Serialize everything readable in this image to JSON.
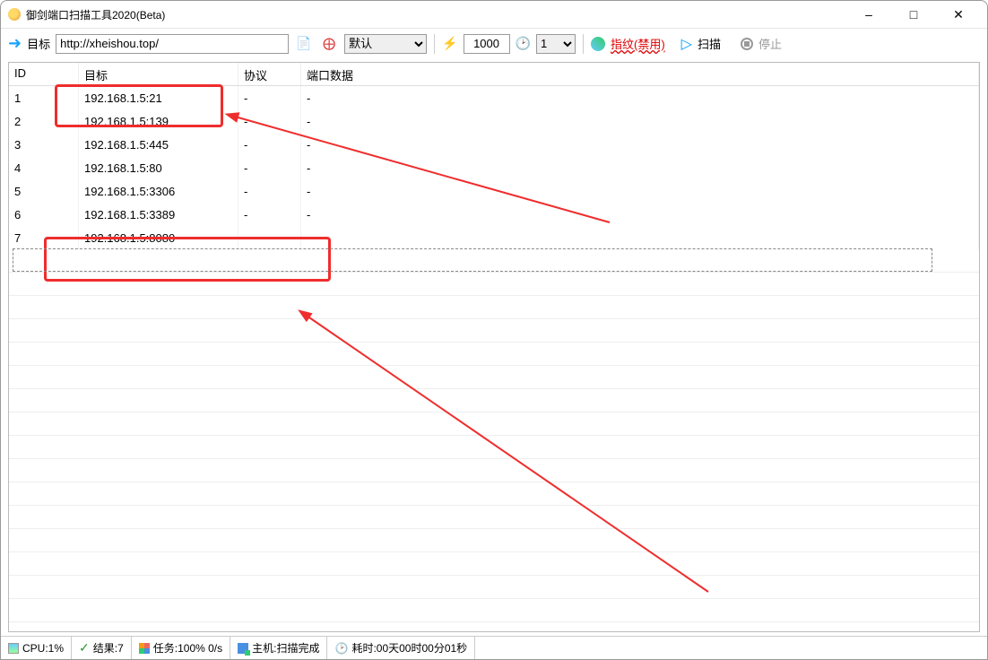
{
  "window": {
    "title": "御剑端口扫描工具2020(Beta)"
  },
  "toolbar": {
    "target_label": "目标",
    "url_value": "http://xheishou.top/",
    "mode_options": [
      "默认"
    ],
    "mode_value": "默认",
    "threads_value": "1000",
    "parallel_value": "1",
    "fingerprint_label": "指纹(禁用)",
    "scan_label": "扫描",
    "stop_label": "停止"
  },
  "columns": {
    "id": "ID",
    "target": "目标",
    "proto": "协议",
    "data": "端口数据"
  },
  "rows": [
    {
      "id": "1",
      "target": "192.168.1.5:21",
      "proto": "-",
      "data": "-"
    },
    {
      "id": "2",
      "target": "192.168.1.5:139",
      "proto": "-",
      "data": "-"
    },
    {
      "id": "3",
      "target": "192.168.1.5:445",
      "proto": "-",
      "data": "-"
    },
    {
      "id": "4",
      "target": "192.168.1.5:80",
      "proto": "-",
      "data": "-"
    },
    {
      "id": "5",
      "target": "192.168.1.5:3306",
      "proto": "-",
      "data": "-"
    },
    {
      "id": "6",
      "target": "192.168.1.5:3389",
      "proto": "-",
      "data": "-"
    },
    {
      "id": "7",
      "target": "192.168.1.5:8080",
      "proto": "-",
      "data": "-"
    }
  ],
  "status": {
    "cpu": "CPU:1%",
    "results": "结果:7",
    "tasks": "任务:100% 0/s",
    "host": "主机:扫描完成",
    "elapsed": "耗时:00天00时00分01秒"
  }
}
